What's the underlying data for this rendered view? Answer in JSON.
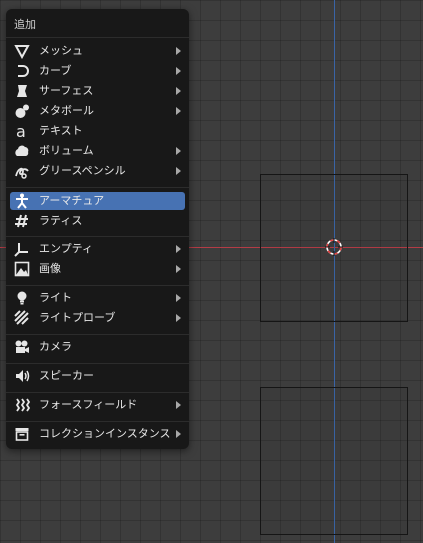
{
  "menu": {
    "title": "追加",
    "items": [
      {
        "label": "メッシュ",
        "icon": "mesh-icon",
        "submenu": true
      },
      {
        "label": "カーブ",
        "icon": "curve-icon",
        "submenu": true
      },
      {
        "label": "サーフェス",
        "icon": "surface-icon",
        "submenu": true
      },
      {
        "label": "メタボール",
        "icon": "metaball-icon",
        "submenu": true
      },
      {
        "label": "テキスト",
        "icon": "text-icon",
        "submenu": false
      },
      {
        "label": "ボリューム",
        "icon": "volume-icon",
        "submenu": true
      },
      {
        "label": "グリースペンシル",
        "icon": "grease-pencil-icon",
        "submenu": true
      },
      {
        "label": "アーマチュア",
        "icon": "armature-icon",
        "submenu": false,
        "active": true
      },
      {
        "label": "ラティス",
        "icon": "lattice-icon",
        "submenu": false
      },
      {
        "label": "エンプティ",
        "icon": "empty-icon",
        "submenu": true
      },
      {
        "label": "画像",
        "icon": "image-icon",
        "submenu": true
      },
      {
        "label": "ライト",
        "icon": "light-icon",
        "submenu": true
      },
      {
        "label": "ライトプローブ",
        "icon": "light-probe-icon",
        "submenu": true
      },
      {
        "label": "カメラ",
        "icon": "camera-icon",
        "submenu": false
      },
      {
        "label": "スピーカー",
        "icon": "speaker-icon",
        "submenu": false
      },
      {
        "label": "フォースフィールド",
        "icon": "force-field-icon",
        "submenu": true
      },
      {
        "label": "コレクションインスタンス",
        "icon": "collection-instance-icon",
        "submenu": true
      }
    ]
  },
  "colors": {
    "accent": "#4772b3",
    "x_axis": "#b43c46",
    "y_axis": "#3a64a6",
    "cursor": "#e04040"
  }
}
